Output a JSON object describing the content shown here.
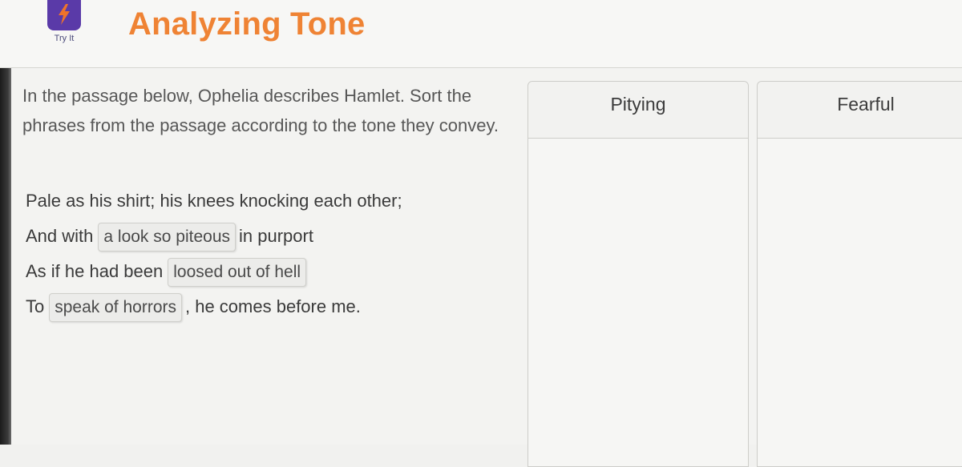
{
  "header": {
    "try_it_label": "Try It",
    "title": "Analyzing Tone"
  },
  "instructions": "In the passage below, Ophelia describes Hamlet. Sort the phrases from the passage according to the tone they convey.",
  "passage": {
    "line1": "Pale as his shirt; his knees knocking each other;",
    "line2_pre": "And with",
    "line2_chip": "a look so piteous",
    "line2_post": "in purport",
    "line3_pre": "As if he had been",
    "line3_chip": "loosed out of hell",
    "line4_pre": "To",
    "line4_chip": "speak of horrors",
    "line4_post": ", he comes before me."
  },
  "bins": [
    {
      "label": "Pitying"
    },
    {
      "label": "Fearful"
    }
  ],
  "colors": {
    "title": "#ef8334",
    "badge": "#5a3aa8"
  },
  "icons": {
    "try_it": "lightning-icon"
  }
}
